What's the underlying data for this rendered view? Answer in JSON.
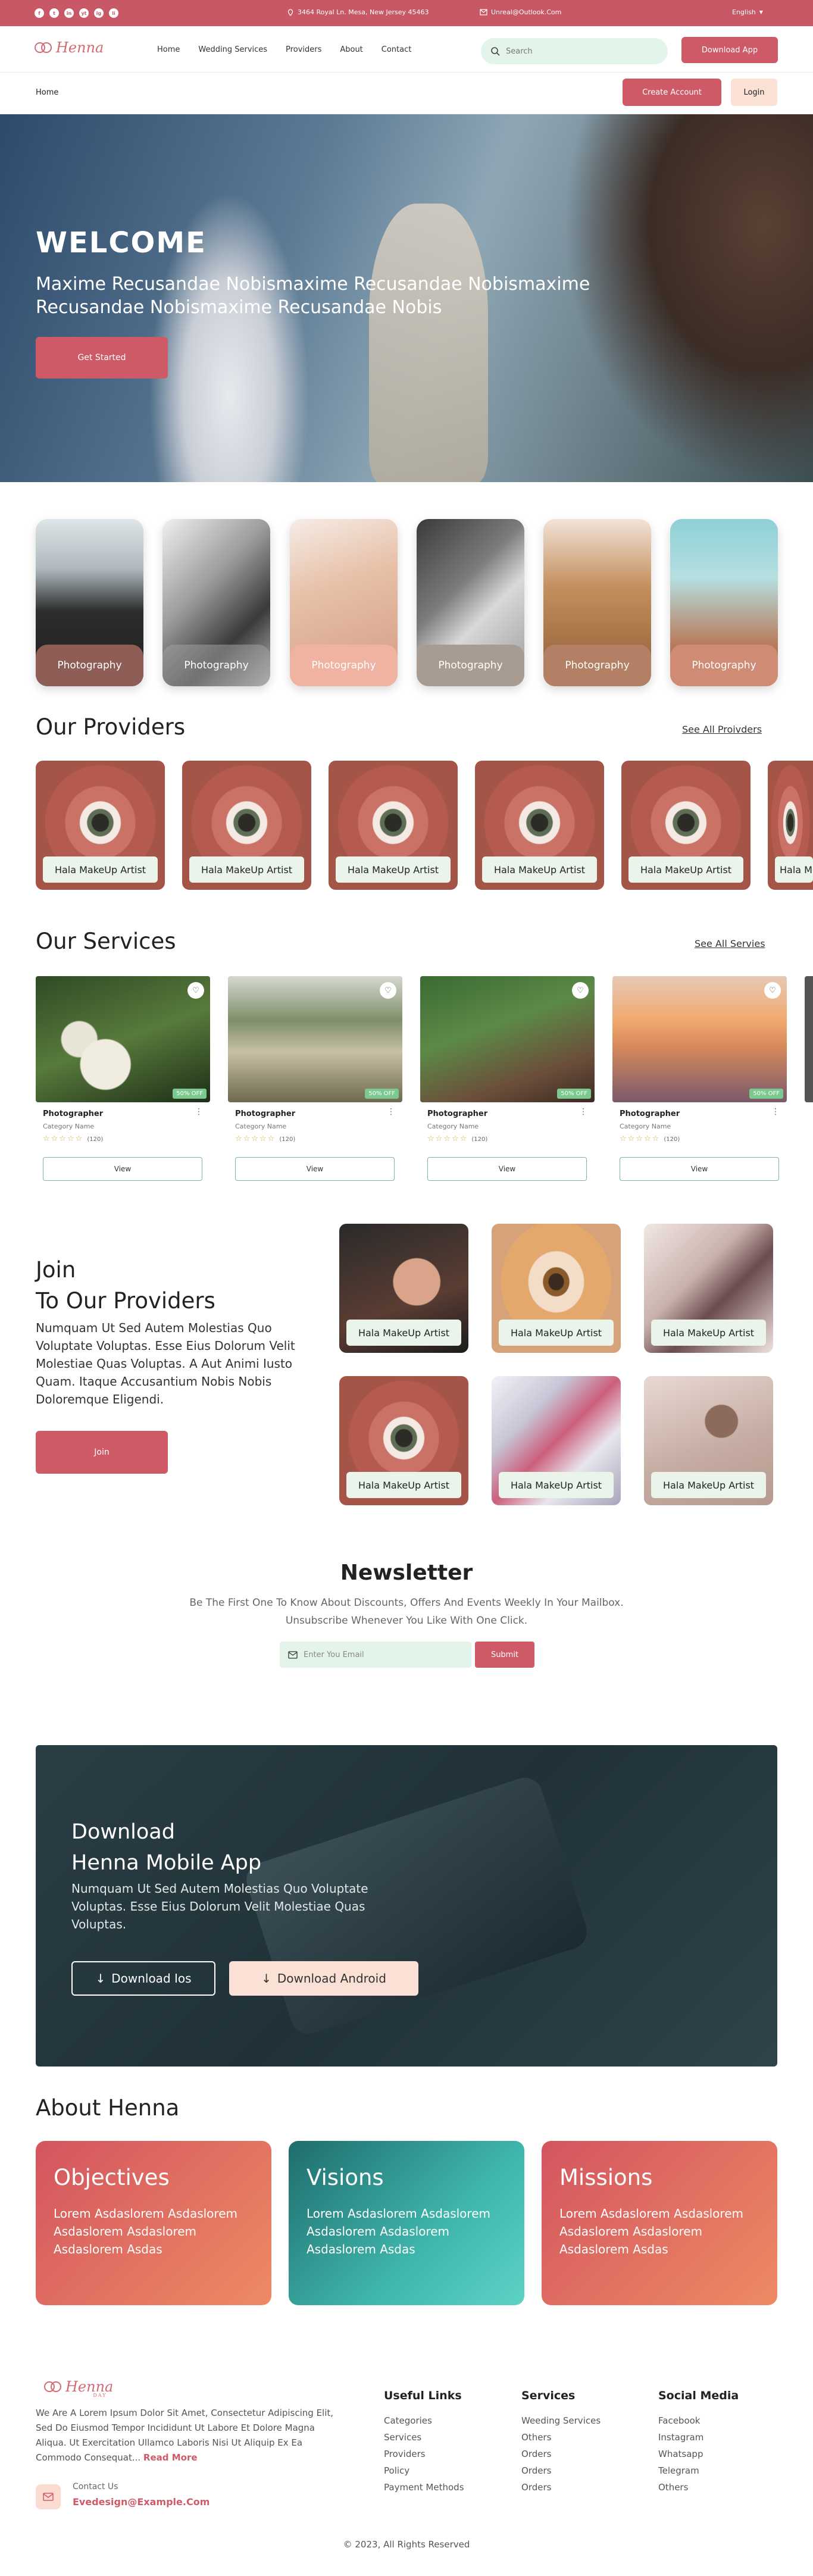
{
  "topbar": {
    "social": [
      "f",
      "t",
      "in",
      "yt",
      "ig",
      "li"
    ],
    "address": "3464 Royal Ln. Mesa, New Jersey 45463",
    "email": "Unreal@Outlook.Com",
    "language": "English"
  },
  "brand": {
    "name": "Henna",
    "tagline": "DAY"
  },
  "nav": {
    "links": [
      "Home",
      "Wedding Services",
      "Providers",
      "About",
      "Contact"
    ],
    "search_placeholder": "Search",
    "download_app": "Download App"
  },
  "breadcrumb": "Home",
  "auth": {
    "create_account": "Create Account",
    "login": "Login"
  },
  "hero": {
    "title": "WELCOME",
    "subtitle": "Maxime Recusandae Nobismaxime Recusandae Nobismaxime Recusandae Nobismaxime Recusandae Nobis",
    "cta": "Get Started"
  },
  "categories": [
    "Photography",
    "Photography",
    "Photography",
    "Photography",
    "Photography",
    "Photography"
  ],
  "providers": {
    "title": "Our Providers",
    "see_all": "See All Proivders",
    "items": [
      "Hala MakeUp Artist",
      "Hala MakeUp Artist",
      "Hala MakeUp Artist",
      "Hala MakeUp Artist",
      "Hala MakeUp Artist",
      "Hala MakeUp Artist"
    ]
  },
  "services": {
    "title": "Our Services",
    "see_all": "See All Servies",
    "items": [
      {
        "title": "Photographer",
        "category": "Category Name",
        "rating": 0,
        "reviews": "(120)",
        "discount": "50% OFF",
        "action": "View"
      },
      {
        "title": "Photographer",
        "category": "Category Name",
        "rating": 0,
        "reviews": "(120)",
        "discount": "50% OFF",
        "action": "View"
      },
      {
        "title": "Photographer",
        "category": "Category Name",
        "rating": 0,
        "reviews": "(120)",
        "discount": "50% OFF",
        "action": "View"
      },
      {
        "title": "Photographer",
        "category": "Category Name",
        "rating": 0,
        "reviews": "(120)",
        "discount": "50% OFF",
        "action": "View"
      }
    ]
  },
  "join": {
    "title_line1": "Join",
    "title_line2": "To Our Providers",
    "text": "Numquam Ut Sed Autem Molestias Quo Voluptate Voluptas. Esse Eius Dolorum Velit Molestiae Quas Voluptas. A Aut Animi Iusto Quam. Itaque Accusantium Nobis Nobis Doloremque Eligendi.",
    "cta": "Join",
    "cards": [
      "Hala MakeUp Artist",
      "Hala MakeUp Artist",
      "Hala MakeUp Artist",
      "Hala MakeUp Artist",
      "Hala MakeUp Artist",
      "Hala MakeUp Artist"
    ]
  },
  "newsletter": {
    "title": "Newsletter",
    "text": "Be The First One To Know  About Discounts, Offers And Events Weekly In Your Mailbox. Unsubscribe Whenever You Like With One Click.",
    "placeholder": "Enter You Email",
    "submit": "Submit"
  },
  "download": {
    "title_line1": "Download",
    "title_line2": "Henna Mobile App",
    "text": "Numquam Ut Sed Autem Molestias Quo Voluptate Voluptas. Esse Eius Dolorum Velit Molestiae Quas Voluptas.",
    "ios": "Download Ios",
    "android": "Download Android"
  },
  "about": {
    "title": "About Henna",
    "cards": [
      {
        "title": "Objectives",
        "text": "Lorem Asdaslorem Asdaslorem Asdaslorem Asdaslorem Asdaslorem Asdas"
      },
      {
        "title": "Visions",
        "text": "Lorem Asdaslorem Asdaslorem Asdaslorem Asdaslorem Asdaslorem Asdas"
      },
      {
        "title": "Missions",
        "text": "Lorem Asdaslorem Asdaslorem Asdaslorem Asdaslorem Asdaslorem Asdas"
      }
    ]
  },
  "footer": {
    "description": "We Are A Lorem Ipsum Dolor Sit Amet, Consectetur Adipiscing Elit, Sed Do Eiusmod Tempor Incididunt Ut Labore Et Dolore Magna Aliqua. Ut Exercitation Ullamco Laboris Nisi Ut Aliquip Ex Ea Commodo Consequat...",
    "read_more": "Read More",
    "contact_label": "Contact Us",
    "contact_email": "Evedesign@Example.Com",
    "useful_links": {
      "title": "Useful Links",
      "items": [
        "Categories",
        "Services",
        "Providers",
        "Policy",
        "Payment Methods"
      ]
    },
    "services": {
      "title": "Services",
      "items": [
        "Weeding Services",
        "Others",
        "Orders",
        "Orders",
        "Orders"
      ]
    },
    "social": {
      "title": "Social Media",
      "items": [
        "Facebook",
        "Instagram",
        "Whatsapp",
        "Telegram",
        "Others"
      ]
    },
    "copyright": "© 2023, All Rights Reserved"
  },
  "colors": {
    "primary": "#cf5a67",
    "mint": "#e3f5ea",
    "peach": "#fbe0d6"
  }
}
